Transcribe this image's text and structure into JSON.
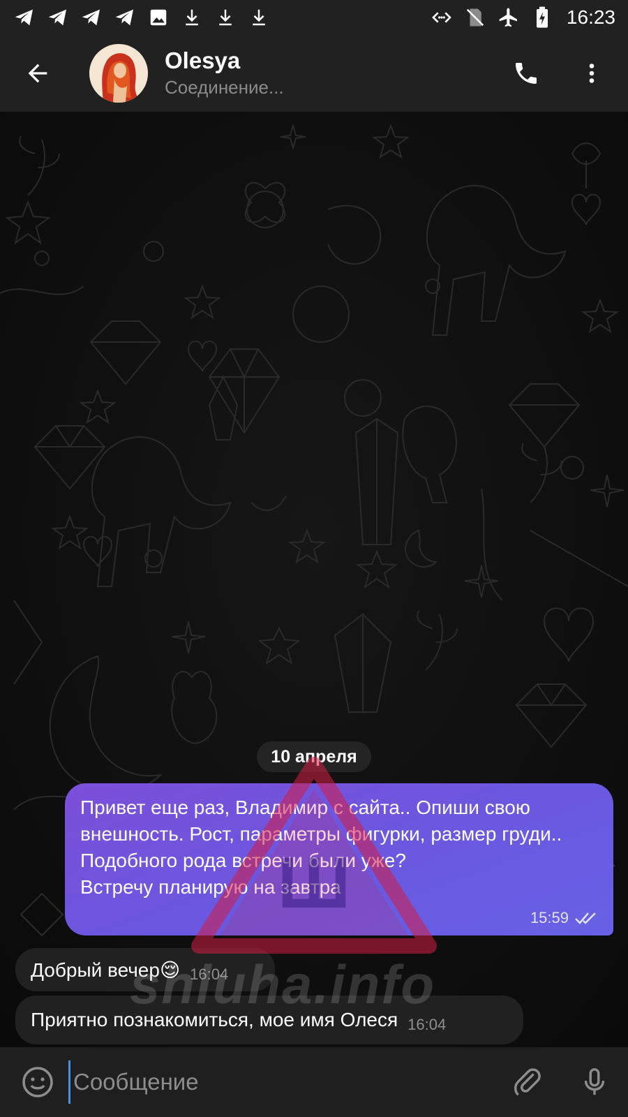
{
  "status_bar": {
    "time": "16:23",
    "left_icons": [
      "telegram-icon",
      "telegram-icon",
      "telegram-icon",
      "telegram-icon",
      "gallery-icon",
      "download-icon",
      "download-icon",
      "download-icon"
    ],
    "right_icons": [
      "data-saver-icon",
      "no-sim-icon",
      "airplane-icon",
      "battery-charging-icon"
    ]
  },
  "header": {
    "contact_name": "Olesya",
    "status": "Соединение...",
    "icons": {
      "back": "arrow-left-icon",
      "call": "phone-icon",
      "menu": "more-vertical-icon"
    }
  },
  "chat": {
    "date_separator": "10 апреля",
    "messages": [
      {
        "direction": "outgoing",
        "text": "Привет еще раз, Владимир с сайта.. Опиши свою внешность. Рост, параметры фигурки, размер груди..\nПодобного рода встречи были уже?\nВстречу планирую на завтра",
        "time": "15:59",
        "read_status": "double-check-icon"
      },
      {
        "direction": "incoming",
        "text": "Добрый вечер😌",
        "time": "16:04"
      },
      {
        "direction": "incoming",
        "text": "Приятно познакомиться, мое имя Олеся",
        "time": "16:04"
      }
    ],
    "watermark": {
      "letter": "Ш",
      "text": "shluha.info"
    }
  },
  "input_bar": {
    "placeholder": "Сообщение",
    "value": "",
    "icons": {
      "emoji": "smile-icon",
      "attach": "paperclip-icon",
      "mic": "microphone-icon"
    }
  },
  "colors": {
    "accent": "#4b8ee3",
    "outgoing_bubble": "#6a58e0",
    "incoming_bubble": "#212121",
    "bar_background": "#212121"
  }
}
